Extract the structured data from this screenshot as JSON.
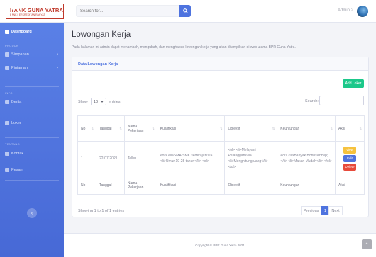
{
  "brand": {
    "title": "BANK GUNA YATRA",
    "subtitle": "BANK PERKREDITAN RAKYAT"
  },
  "topbar": {
    "search_placeholder": "Search for...",
    "username": "Admin 2"
  },
  "sidebar": {
    "dashboard": "Dashboard",
    "section_1": "Produk",
    "simpanan": "Simpanan",
    "pinjaman": "Pinjaman",
    "section_2": "Info",
    "berita": "Berita",
    "loker": "Loker",
    "section_3": "Tentang",
    "kontak": "Kontak",
    "pesan": "Pesan"
  },
  "page": {
    "title": "Lowongan Kerja",
    "description": "Pada halaman ini admin dapat menambah, mengubah, dan menghapus lowongan kerja yang akan ditampilkan di web utama BPR Guna Yatra."
  },
  "card": {
    "title": "Data Lowongan Kerja",
    "add_button": "Add Loker",
    "show_label": "Show",
    "show_value": "10",
    "entries_label": "entries",
    "search_label": "Search:"
  },
  "table": {
    "headers": [
      "No",
      "Tanggal",
      "Nama Pekerjaan",
      "Kualifikasi",
      "Objektif",
      "Keuntungan",
      "Aksi"
    ],
    "rows": [
      {
        "no": "1",
        "tanggal": "22-07-2021",
        "nama": "Teller",
        "kualifikasi": "<ol> <li>SMA/SMK sederajat</li><li>Umur 19-25 tahun</li> <ol>",
        "objektif": "<ol> <li>Melayani Pelanggan</li> <li>Menghitung uang</li> </ol>",
        "keuntungan": "<ol> <li>Banyak Bonus&nbsp;</li> <li>Makan Mudah</li> </ol>",
        "view": "View",
        "edit": "Edit",
        "delete": "Delete"
      }
    ]
  },
  "pagination": {
    "showing": "Showing 1 to 1 of 1 entries",
    "previous": "Previous",
    "page": "1",
    "next": "Next"
  },
  "footer": {
    "copyright": "Copyright © BPR Guna Yatra 2021"
  }
}
